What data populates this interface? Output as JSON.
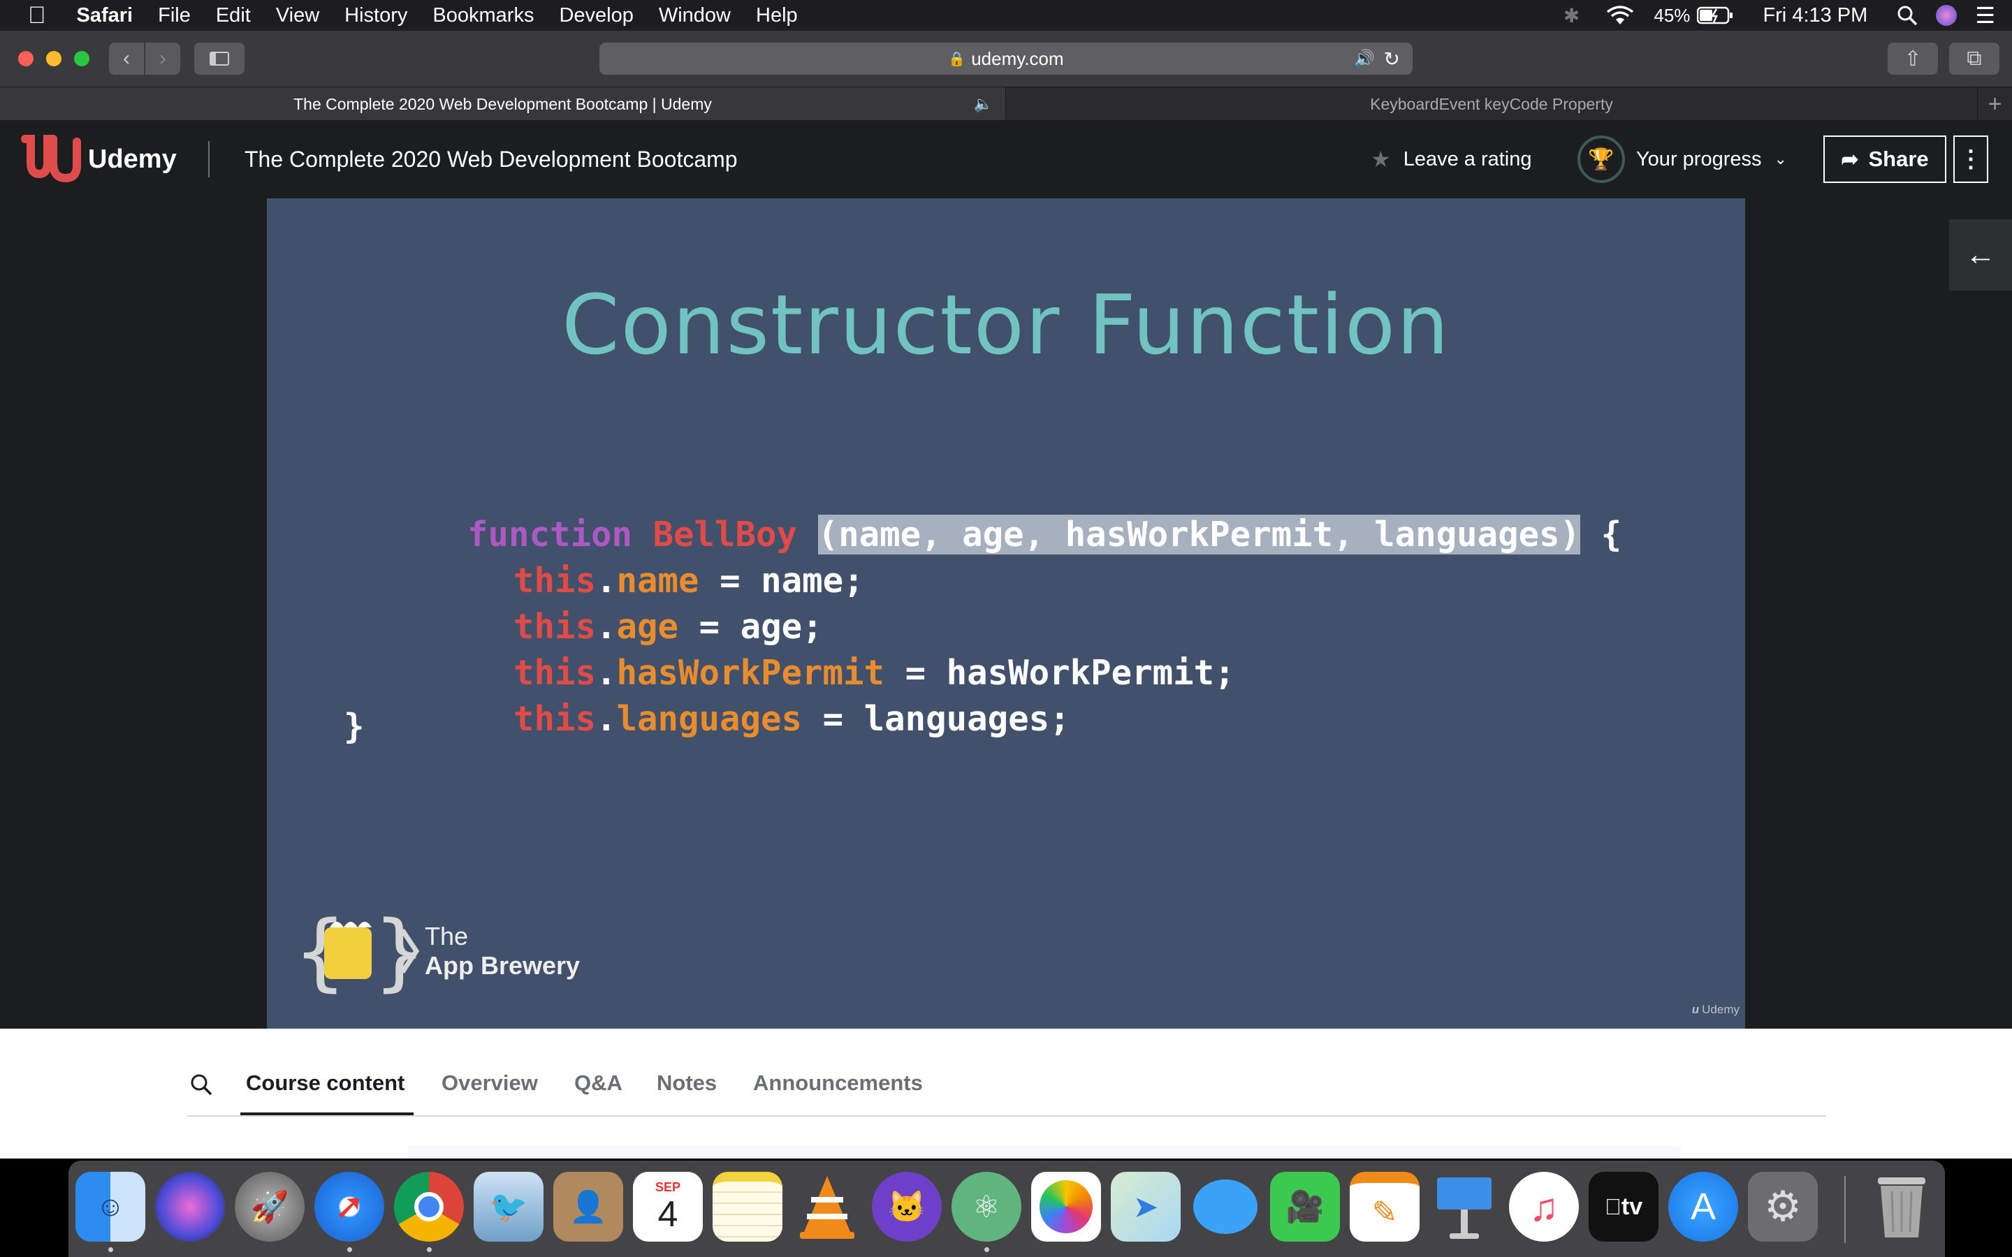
{
  "menubar": {
    "app_name": "Safari",
    "items": [
      "File",
      "Edit",
      "View",
      "History",
      "Bookmarks",
      "Develop",
      "Window",
      "Help"
    ],
    "battery": "45%",
    "clock": "Fri 4:13 PM"
  },
  "browser": {
    "url": "udemy.com",
    "tabs": [
      {
        "title": "The Complete 2020 Web Development Bootcamp | Udemy",
        "active": true
      },
      {
        "title": "KeyboardEvent keyCode Property",
        "active": false
      }
    ]
  },
  "udemy": {
    "logo_text": "Udemy",
    "course_title": "The Complete 2020 Web Development Bootcamp",
    "rating_label": "Leave a rating",
    "progress_label": "Your progress",
    "share_label": "Share"
  },
  "slide": {
    "title": "Constructor Function",
    "code": {
      "kw_function": "function",
      "fn_name": "BellBoy",
      "params": "(name, age, hasWorkPermit, languages)",
      "open_brace": "{",
      "close_brace": "}",
      "this_kw": "this",
      "lines": [
        {
          "prop": "name",
          "rhs": " = name;"
        },
        {
          "prop": "age",
          "rhs": " = age;"
        },
        {
          "prop": "hasWorkPermit",
          "rhs": " = hasWorkPermit;"
        },
        {
          "prop": "languages",
          "rhs": " = languages;"
        }
      ]
    },
    "brand_line1": "The",
    "brand_line2": "App Brewery",
    "watermark": "Udemy"
  },
  "lower_tabs": [
    "Course content",
    "Overview",
    "Q&A",
    "Notes",
    "Announcements"
  ],
  "dock": [
    "finder",
    "siri",
    "launchpad",
    "safari",
    "chrome",
    "mail",
    "contacts",
    "calendar",
    "notes",
    "vlc",
    "github-desktop",
    "atom",
    "photos",
    "maps",
    "messages",
    "facetime",
    "pages",
    "keynote",
    "music",
    "apple-tv",
    "app-store",
    "system-preferences",
    "trash"
  ],
  "calendar_month": "SEP",
  "calendar_day": "4",
  "appletv_label": "tv",
  "colors": {
    "slide_bg": "#42516b",
    "title_teal": "#70c3c1",
    "udemy_red": "#e04b4b"
  }
}
